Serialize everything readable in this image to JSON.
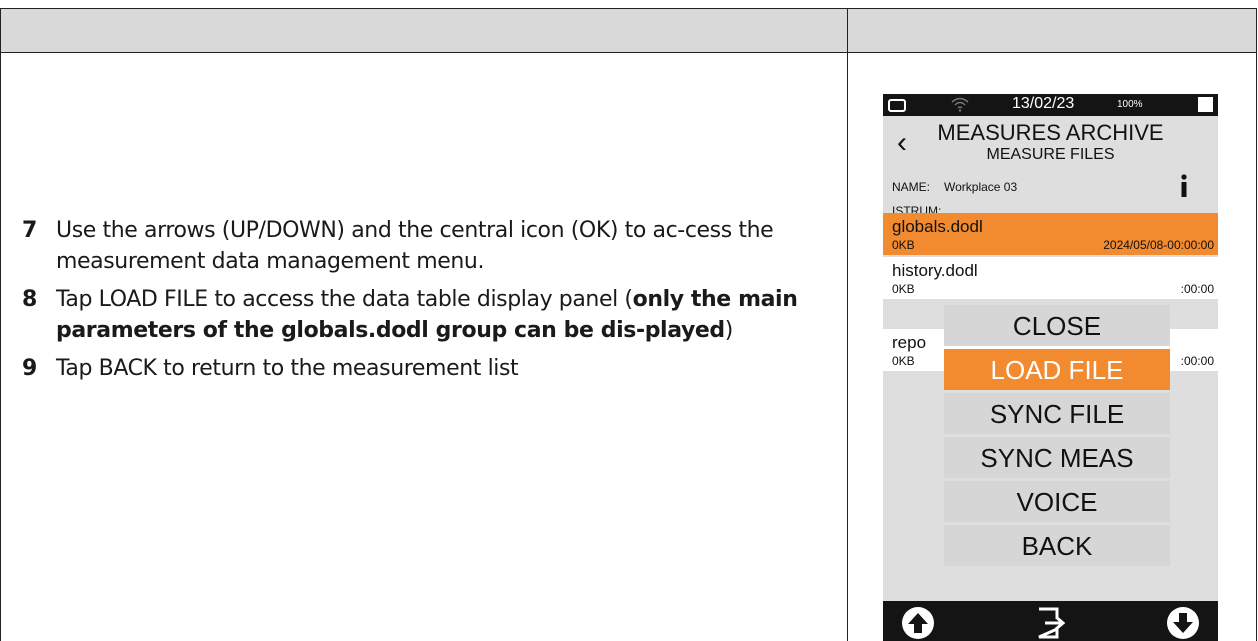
{
  "steps": [
    {
      "num": "7",
      "text": "Use the arrows (UP/DOWN) and the central icon (OK) to ac-cess the measurement data management menu."
    },
    {
      "num": "8",
      "text_before": "Tap LOAD FILE to access the data table display panel (",
      "bold": "only the main parameters of the globals.dodl group can be dis-played",
      "text_after": ")"
    },
    {
      "num": "9",
      "text": "Tap BACK to return to the measurement list"
    }
  ],
  "device": {
    "status": {
      "date": "13/02/23",
      "battery": "100%"
    },
    "title": "MEASURES ARCHIVE",
    "subtitle": "MEASURE FILES",
    "name_label": "NAME:",
    "name_value": "Workplace 03",
    "istrum_label": "ISTRUM:",
    "files": [
      {
        "name": "globals.dodl",
        "size": "0KB",
        "date": "2024/05/08-00:00:00"
      },
      {
        "name": "history.dodl",
        "size": "0KB",
        "date": ":00:00"
      },
      {
        "name": "repo",
        "size": "0KB",
        "date": ":00:00"
      }
    ],
    "menu": [
      {
        "label": "CLOSE"
      },
      {
        "label": "LOAD FILE"
      },
      {
        "label": "SYNC FILE"
      },
      {
        "label": "SYNC MEAS"
      },
      {
        "label": "VOICE"
      },
      {
        "label": "BACK"
      }
    ],
    "colors": {
      "accent": "#f28a30",
      "bar": "#141414",
      "screen": "#dedede"
    },
    "nav_icons": [
      "arrow-up-icon",
      "enter-icon",
      "arrow-down-icon"
    ]
  }
}
